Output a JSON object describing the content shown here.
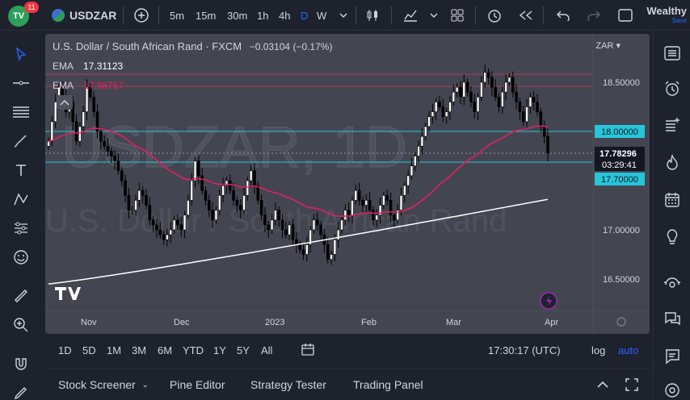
{
  "topbar": {
    "notifications": "11",
    "symbol": "USDZAR",
    "intervals": [
      "5m",
      "15m",
      "30m",
      "1h",
      "4h",
      "D",
      "W"
    ],
    "active_interval": "D",
    "user_name": "Wealthy",
    "save_label": "Save"
  },
  "chart": {
    "instrument_title": "U.S. Dollar / South African Rand · FXCM",
    "change": "−0.03104 (−0.17%)",
    "ema1_label": "EMA",
    "ema1_value": "17.31123",
    "ema2_label": "EMA",
    "ema2_value": "17.98757",
    "currency": "ZAR",
    "watermark_symbol": "USDZAR, 1D",
    "watermark_name": "U.S. Dollar / South African Rand",
    "last_price": "17.78296",
    "countdown": "03:29:41",
    "level_high": "18.00000",
    "level_low": "17.70000",
    "price_ticks": [
      "18.50000",
      "17.00000",
      "16.50000"
    ],
    "time_ticks": [
      "Nov",
      "Dec",
      "2023",
      "Feb",
      "Mar",
      "Apr"
    ],
    "colors": {
      "up": "#ffffff",
      "down": "#000000",
      "ema_fast": "#e91e63",
      "ema_slow": "#ffffff",
      "level": "#26c6da",
      "panel": "#434651"
    }
  },
  "chart_data": {
    "type": "candlestick",
    "y_axis_ticks": [
      18.5,
      18.0,
      17.7,
      17.0,
      16.5
    ],
    "x_axis_ticks": [
      "Nov",
      "Dec",
      "2023",
      "Feb",
      "Mar",
      "Apr"
    ],
    "horizontal_levels": [
      18.0,
      17.7
    ],
    "resistance_band": [
      18.5,
      18.6
    ],
    "last_price": 17.78296,
    "ema_fast_value": 17.98757,
    "ema_slow_value": 17.31123,
    "close_path": [
      17.9,
      18.1,
      18.3,
      18.45,
      18.35,
      18.2,
      18.3,
      18.1,
      17.9,
      18.05,
      18.2,
      18.45,
      18.35,
      18.2,
      18.0,
      17.9,
      17.85,
      17.8,
      17.75,
      17.7,
      17.6,
      17.5,
      17.35,
      17.2,
      17.2,
      17.3,
      17.4,
      17.35,
      17.25,
      17.1,
      17.05,
      17.0,
      16.95,
      16.9,
      16.95,
      17.0,
      17.1,
      17.05,
      17.0,
      17.15,
      17.3,
      17.5,
      17.7,
      17.55,
      17.4,
      17.3,
      17.2,
      17.1,
      17.2,
      17.35,
      17.45,
      17.5,
      17.4,
      17.3,
      17.25,
      17.2,
      17.35,
      17.5,
      17.6,
      17.45,
      17.3,
      17.15,
      17.05,
      17.0,
      17.1,
      17.2,
      17.1,
      17.0,
      16.95,
      17.05,
      16.9,
      16.85,
      16.8,
      16.75,
      16.85,
      17.0,
      17.1,
      17.05,
      16.95,
      16.85,
      16.7,
      16.75,
      16.9,
      17.0,
      17.1,
      17.2,
      17.15,
      17.3,
      17.4,
      17.3,
      17.25,
      17.3,
      17.2,
      17.1,
      17.15,
      17.25,
      17.35,
      17.3,
      17.15,
      17.1,
      17.2,
      17.35,
      17.45,
      17.55,
      17.65,
      17.75,
      17.85,
      17.95,
      18.05,
      18.15,
      18.2,
      18.3,
      18.25,
      18.15,
      18.2,
      18.3,
      18.4,
      18.45,
      18.35,
      18.5,
      18.4,
      18.3,
      18.2,
      18.35,
      18.5,
      18.6,
      18.55,
      18.45,
      18.35,
      18.25,
      18.4,
      18.5,
      18.55,
      18.4,
      18.3,
      18.2,
      18.1,
      18.25,
      18.35,
      18.3,
      18.2,
      18.05,
      17.95,
      17.78
    ]
  }
}
